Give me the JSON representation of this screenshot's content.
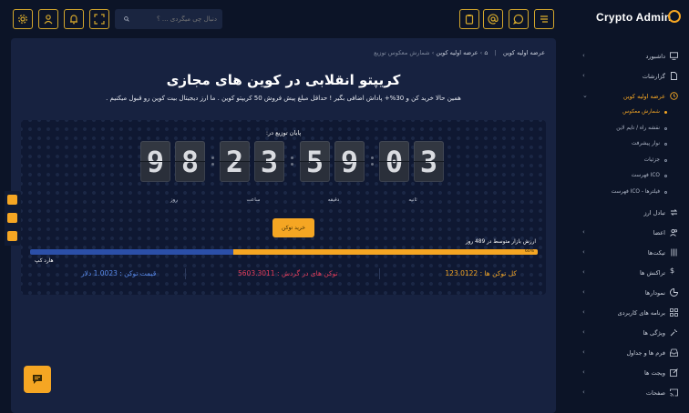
{
  "app": {
    "brand": "Crypto Admin"
  },
  "search": {
    "placeholder": "دنبال چی میگردی ... ؟"
  },
  "topbar": {
    "left_icons": [
      "settings-icon",
      "user-icon",
      "bell-icon",
      "fullscreen-icon"
    ],
    "right_icons": [
      "clipboard-icon",
      "at-icon",
      "chat-icon",
      "menu-icon"
    ]
  },
  "sidebar": {
    "items": [
      {
        "label": "داشبورد",
        "icon": "monitor-icon"
      },
      {
        "label": "گزارشات",
        "icon": "report-icon"
      },
      {
        "label": "عرضه اولیه کوین",
        "icon": "clock-icon",
        "active": true
      },
      {
        "label": "تبادل ارز",
        "icon": "exchange-icon"
      },
      {
        "label": "اعضا",
        "icon": "users-icon"
      },
      {
        "label": "تیکت‌ها",
        "icon": "sliders-icon"
      },
      {
        "label": "تراکنش ها",
        "icon": "dollar-icon"
      },
      {
        "label": "نمودارها",
        "icon": "chart-icon"
      },
      {
        "label": "برنامه های کاربردی",
        "icon": "grid-icon"
      },
      {
        "label": "ویژگی ها",
        "icon": "tools-icon"
      },
      {
        "label": "فرم ها و جداول",
        "icon": "inbox-icon"
      },
      {
        "label": "ویجت ها",
        "icon": "edit-icon"
      },
      {
        "label": "صفحات",
        "icon": "cast-icon"
      }
    ],
    "subitems": [
      {
        "label": "شمارش معکوس",
        "active": true
      },
      {
        "label": "نقشه راه / تایم لاین"
      },
      {
        "label": "نوار پیشرفت"
      },
      {
        "label": "جزئیات"
      },
      {
        "label": "فهرست ICO"
      },
      {
        "label": "فهرست ICO - فیلترها"
      }
    ]
  },
  "breadcrumb": {
    "title": "عرضه اولیه کوین",
    "path": "عرضه اولیه کوین",
    "current": "شمارش معکوس توزیع"
  },
  "hero": {
    "title": "کریپتو انقلابی در کوین های مجازی",
    "subtitle": "همین حالا خرید کن و 30%+ پاداش اضافی بگیر ! حداقل مبلغ پیش فروش 50 کریپتو کوین . ما ارز دیجیتال بیت کوین رو قبول میکنیم ."
  },
  "countdown": {
    "label": "پایان توزیع در:",
    "days": [
      "9",
      "8"
    ],
    "hours": [
      "2",
      "3"
    ],
    "minutes": [
      "5",
      "9"
    ],
    "seconds": [
      "0",
      "3"
    ],
    "unit_days": "روز",
    "unit_hours": "ساعت",
    "unit_minutes": "دقیقه",
    "unit_seconds": "ثانیه"
  },
  "buy_button": "خرید توکن",
  "progress": {
    "label": "ارزش بازار متوسط در 489 روز",
    "fill_fraction": 0.6,
    "inner_text": "60%",
    "hard_cap": "هارد کپ"
  },
  "stats": {
    "total": "کل توکن ها : 123.0122",
    "circulating": "توکن های در گردش : 5603.3011",
    "price": "قیمت توکن : 1.0023 دلار"
  },
  "colors": {
    "accent": "#f5a623",
    "bg": "#0c1427",
    "panel": "#172240",
    "blue": "#2b4fa8",
    "red": "#e83e5c"
  }
}
